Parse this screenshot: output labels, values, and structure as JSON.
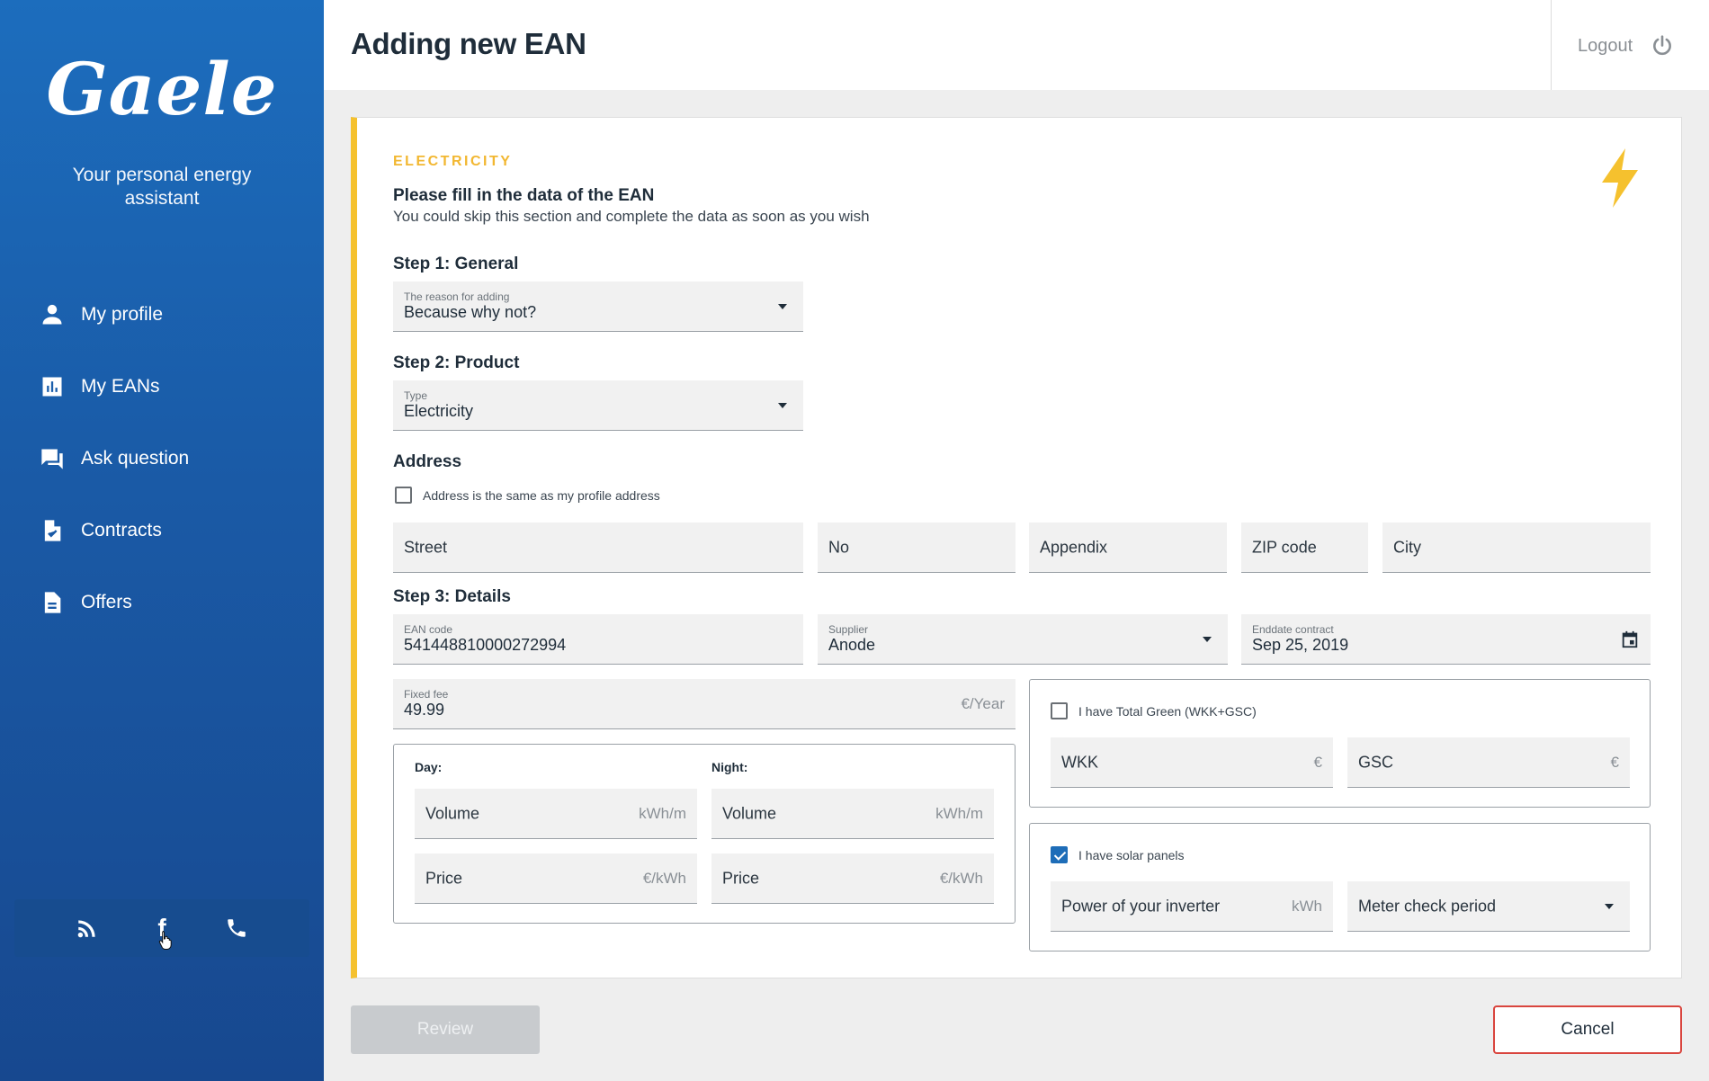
{
  "sidebar": {
    "logo": "Gaele",
    "tagline": "Your personal energy assistant",
    "items": [
      {
        "label": "My profile",
        "icon": "person-icon"
      },
      {
        "label": "My EANs",
        "icon": "bar-chart-icon"
      },
      {
        "label": "Ask question",
        "icon": "chat-icon"
      },
      {
        "label": "Contracts",
        "icon": "document-check-icon"
      },
      {
        "label": "Offers",
        "icon": "document-icon"
      }
    ],
    "social": [
      "rss-icon",
      "facebook-icon",
      "phone-icon"
    ],
    "facebook_glyph": "f"
  },
  "header": {
    "title": "Adding new EAN",
    "logout_label": "Logout"
  },
  "form": {
    "section_label": "ELECTRICITY",
    "intro_title": "Please fill in the data of the EAN",
    "intro_subtitle": "You could skip this section and complete the data as soon as you wish",
    "step1": {
      "title": "Step 1: General",
      "reason_label": "The reason for adding",
      "reason_value": "Because why not?"
    },
    "step2": {
      "title": "Step 2: Product",
      "type_label": "Type",
      "type_value": "Electricity"
    },
    "address": {
      "title": "Address",
      "same_as_profile_label": "Address is the same as my profile address",
      "same_as_profile_checked": false,
      "street": "Street",
      "no": "No",
      "appendix": "Appendix",
      "zip": "ZIP code",
      "city": "City"
    },
    "step3": {
      "title": "Step 3: Details",
      "ean_label": "EAN code",
      "ean_value": "541448810000272994",
      "supplier_label": "Supplier",
      "supplier_value": "Anode",
      "enddate_label": "Enddate contract",
      "enddate_value": "Sep 25, 2019",
      "fixed_fee_label": "Fixed fee",
      "fixed_fee_value": "49.99",
      "fixed_fee_unit": "€/Year",
      "day_label": "Day:",
      "night_label": "Night:",
      "volume_placeholder": "Volume",
      "volume_unit": "kWh/m",
      "price_placeholder": "Price",
      "price_unit": "€/kWh",
      "green_label": "I have Total Green (WKK+GSC)",
      "green_checked": false,
      "wkk_placeholder": "WKK",
      "gsc_placeholder": "GSC",
      "euro_unit": "€",
      "solar_label": "I have solar panels",
      "solar_checked": true,
      "inverter_placeholder": "Power of your inverter",
      "inverter_unit": "kWh",
      "meter_check_placeholder": "Meter check period"
    }
  },
  "buttons": {
    "review": "Review",
    "cancel": "Cancel"
  },
  "colors": {
    "sidebar_blue": "#1c6dbd",
    "accent_yellow": "#f5c12e",
    "cancel_red": "#d9453e",
    "checkbox_blue": "#1e6db8"
  }
}
